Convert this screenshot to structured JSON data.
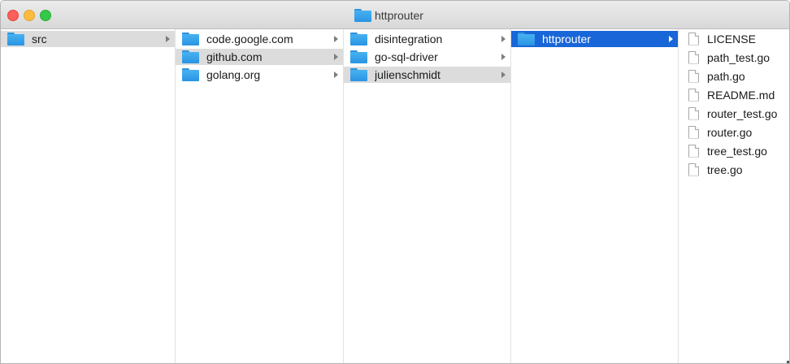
{
  "window": {
    "title": "httprouter"
  },
  "columns": [
    {
      "items": [
        {
          "label": "src",
          "state": "gray"
        }
      ]
    },
    {
      "items": [
        {
          "label": "code.google.com",
          "state": "none"
        },
        {
          "label": "github.com",
          "state": "gray"
        },
        {
          "label": "golang.org",
          "state": "none"
        }
      ]
    },
    {
      "items": [
        {
          "label": "disintegration",
          "state": "none"
        },
        {
          "label": "go-sql-driver",
          "state": "none"
        },
        {
          "label": "julienschmidt",
          "state": "gray"
        }
      ]
    },
    {
      "items": [
        {
          "label": "httprouter",
          "state": "blue"
        }
      ]
    }
  ],
  "files": [
    "LICENSE",
    "path_test.go",
    "path.go",
    "README.md",
    "router_test.go",
    "router.go",
    "tree_test.go",
    "tree.go"
  ],
  "colors": {
    "selection_blue": "#1866d8",
    "selection_gray": "#dcdcdc",
    "folder_blue": "#3aa5ec"
  }
}
